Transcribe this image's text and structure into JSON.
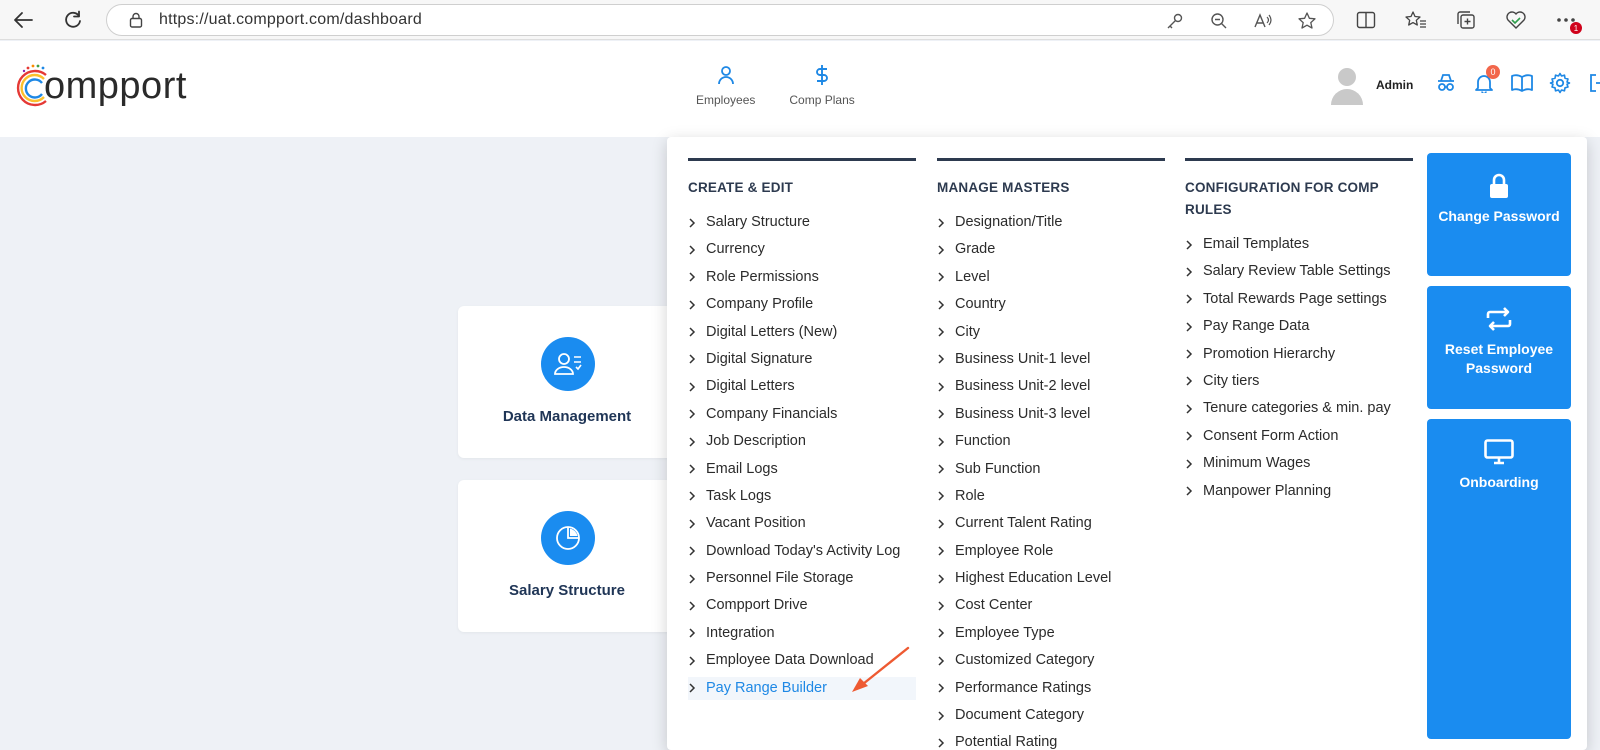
{
  "browser": {
    "url": "https://uat.compport.com/dashboard",
    "notification_badge": "1"
  },
  "app": {
    "logo_text": "ompport",
    "nav": [
      {
        "label": "Employees",
        "icon": "person-icon"
      },
      {
        "label": "Comp Plans",
        "icon": "dollar-icon"
      }
    ],
    "user_name": "Admin",
    "bell_count": "0"
  },
  "cards": [
    {
      "title": "Data Management",
      "icon": "user-checklist-icon"
    },
    {
      "title": "Salary Structure",
      "icon": "pie-chart-icon"
    }
  ],
  "menu": {
    "col1": {
      "heading": "CREATE & EDIT",
      "items": [
        "Salary Structure",
        "Currency",
        "Role Permissions",
        "Company Profile",
        "Digital Letters (New)",
        "Digital Signature",
        "Digital Letters",
        "Company Financials",
        "Job Description",
        "Email Logs",
        "Task Logs",
        "Vacant Position",
        "Download Today's Activity Log",
        "Personnel File Storage",
        "Compport Drive",
        "Integration",
        "Employee Data Download",
        "Pay Range Builder"
      ]
    },
    "col2": {
      "heading": "MANAGE MASTERS",
      "items": [
        "Designation/Title",
        "Grade",
        "Level",
        "Country",
        "City",
        "Business Unit-1 level",
        "Business Unit-2 level",
        "Business Unit-3 level",
        "Function",
        "Sub Function",
        "Role",
        "Current Talent Rating",
        "Employee Role",
        "Highest Education Level",
        "Cost Center",
        "Employee Type",
        "Customized Category",
        "Performance Ratings",
        "Document Category",
        "Potential Rating"
      ]
    },
    "col3": {
      "heading": "CONFIGURATION FOR COMP RULES",
      "items": [
        "Email Templates",
        "Salary Review Table Settings",
        "Total Rewards Page settings",
        "Pay Range Data",
        "Promotion Hierarchy",
        "City tiers",
        "Tenure categories & min. pay",
        "Consent Form Action",
        "Minimum Wages",
        "Manpower Planning"
      ]
    }
  },
  "tiles": [
    {
      "label": "Change Password",
      "icon": "lock-icon"
    },
    {
      "label": "Reset Employee Password",
      "icon": "repeat-icon"
    },
    {
      "label": "Onboarding",
      "icon": "monitor-icon"
    }
  ],
  "colors": {
    "accent": "#1a8cf0",
    "heading": "#2d3a4f",
    "active_link": "#1e88e5",
    "annotation_arrow": "#ee5a32"
  }
}
